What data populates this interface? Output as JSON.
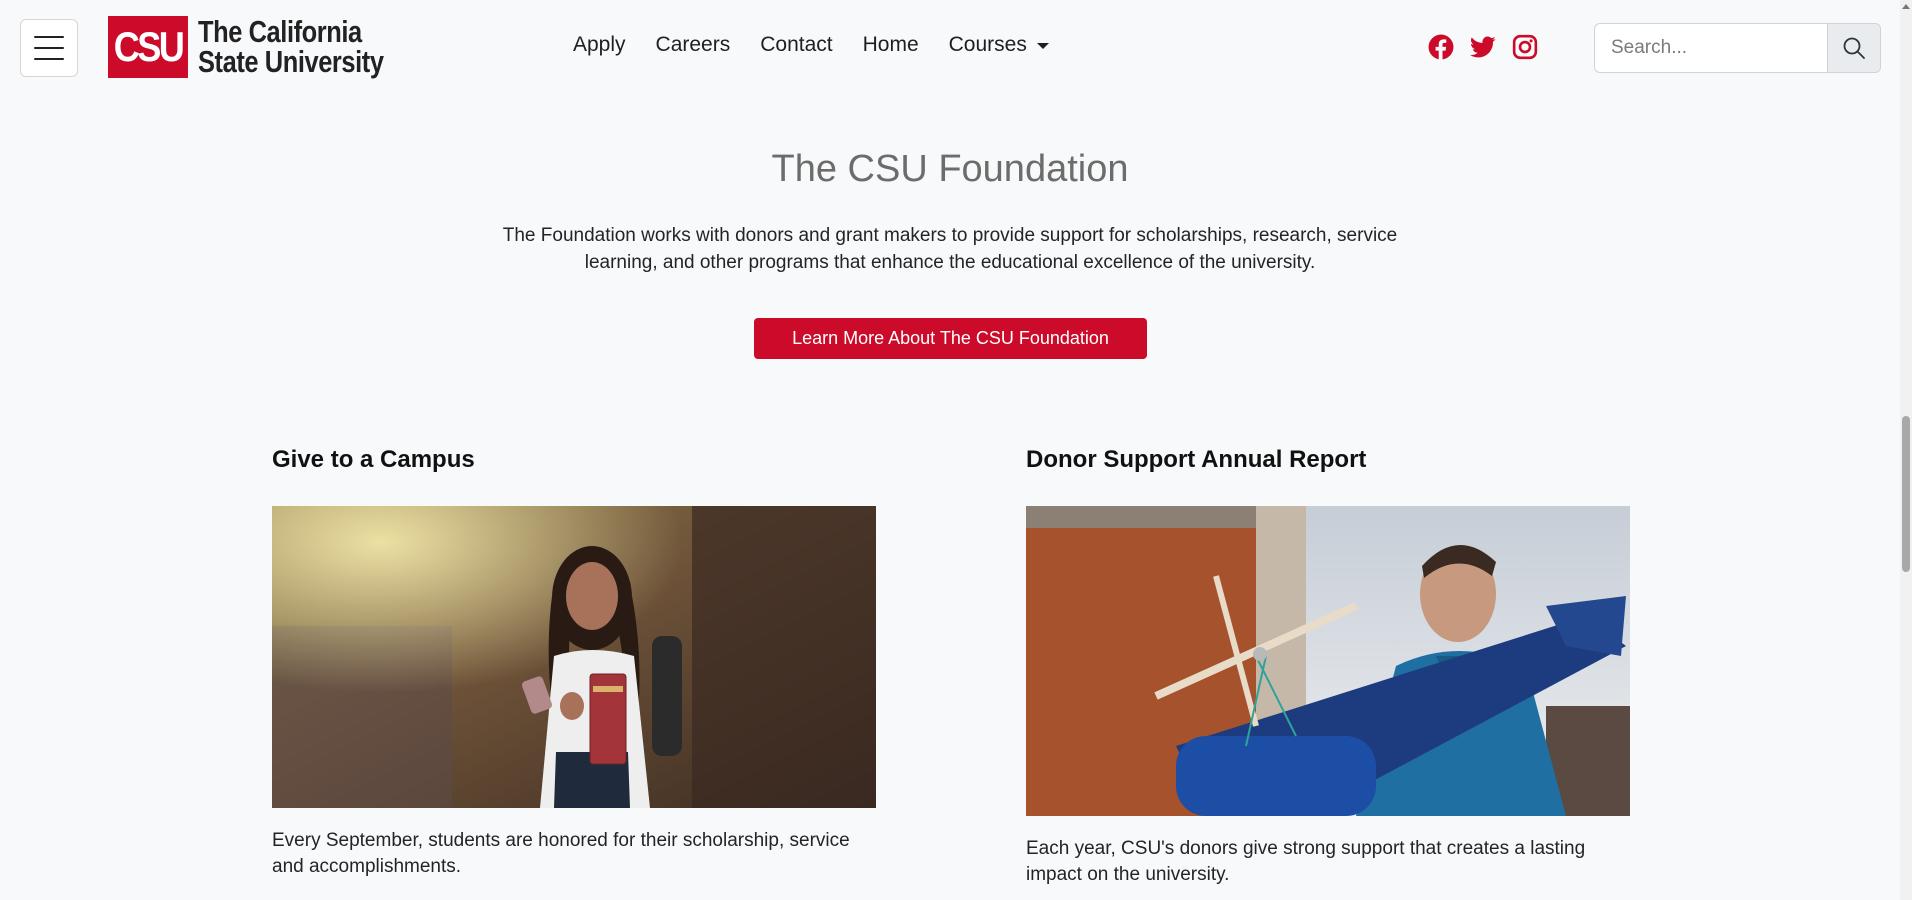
{
  "header": {
    "menu_toggle_label": "Toggle navigation",
    "logo": {
      "mark": "CSU",
      "line1": "The California",
      "line2": "State University"
    },
    "nav": [
      {
        "label": "Apply"
      },
      {
        "label": "Careers"
      },
      {
        "label": "Contact"
      },
      {
        "label": "Home"
      },
      {
        "label": "Courses",
        "dropdown": true
      }
    ],
    "socials": [
      "facebook-icon",
      "twitter-icon",
      "instagram-icon"
    ],
    "search": {
      "placeholder": "Search...",
      "value": ""
    }
  },
  "hero": {
    "title": "The CSU Foundation",
    "description": "The Foundation works with donors and grant makers to provide support for scholarships, research, service learning, and other programs that enhance the educational excellence of the university.",
    "button_label": "Learn More About The CSU Foundation"
  },
  "cards": [
    {
      "title": "Give to a Campus",
      "image": "student-holding-books-photo",
      "text": "Every September, students are honored for their scholarship, service and accomplishments."
    },
    {
      "title": "Donor Support Annual Report",
      "image": "student-with-model-aircraft-photo",
      "text": "Each year, CSU's donors give strong support that creates a lasting impact on the university."
    }
  ],
  "colors": {
    "brand_red": "#cc0b2a",
    "background": "#f8f9fa",
    "title_gray": "#6c6c6c"
  }
}
